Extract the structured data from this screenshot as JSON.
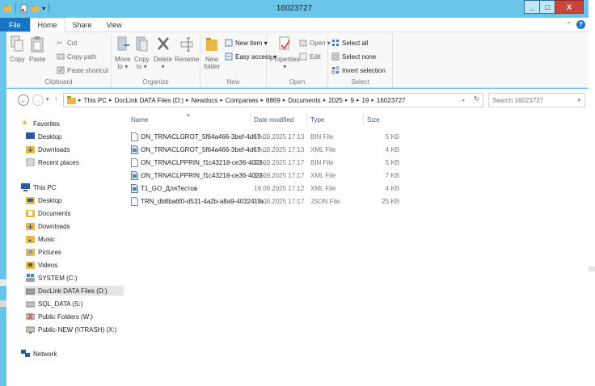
{
  "window": {
    "title": "16023727"
  },
  "caption_buttons": {
    "minimize": "_",
    "maximize": "□",
    "close": "X"
  },
  "ribbon_tabs": [
    {
      "label": "File"
    },
    {
      "label": "Home"
    },
    {
      "label": "Share"
    },
    {
      "label": "View"
    }
  ],
  "ribbon": {
    "clipboard": {
      "label": "Clipboard",
      "copy": "Copy",
      "paste": "Paste",
      "cut": "Cut",
      "copy_path": "Copy path",
      "paste_shortcut": "Paste shortcut"
    },
    "organize": {
      "label": "Organize",
      "move_to": "Move\nto ▾",
      "copy_to": "Copy\nto ▾",
      "delete": "Delete",
      "delete_arrow": "▾",
      "rename": "Rename"
    },
    "new": {
      "label": "New",
      "new_folder": "New\nfolder",
      "new_item": "New item ▾",
      "easy_access": "Easy access ▾"
    },
    "open": {
      "label": "Open",
      "properties": "Properties",
      "properties_arrow": "▾",
      "open": "Open ▾",
      "edit": "Edit"
    },
    "select": {
      "label": "Select",
      "select_all": "Select all",
      "select_none": "Select none",
      "invert_selection": "Invert selection"
    }
  },
  "addressbar": {
    "crumbs": [
      "This PC",
      "DocLink DATA Files (D:)",
      "Newdocs",
      "Companies",
      "8869",
      "Documents",
      "2025",
      "9",
      "19",
      "16023727"
    ],
    "search_placeholder": "Search 16023727"
  },
  "nav_pane": {
    "favorites": "Favorites",
    "favorites_items": [
      "Desktop",
      "Downloads",
      "Recent places"
    ],
    "this_pc": "This PC",
    "this_pc_items": [
      "Desktop",
      "Documents",
      "Downloads",
      "Music",
      "Pictures",
      "Videos",
      "SYSTEM (C:)",
      "DocLink DATA Files (D:)",
      "SQL_DATA (S:)",
      "Public Folders (W:)",
      "Public-NEW (\\\\TRASH) (X:)"
    ],
    "network": "Network"
  },
  "file_list": {
    "columns": {
      "name": "Name",
      "date": "Date modified",
      "type": "Type",
      "size": "Size"
    },
    "rows": [
      {
        "name": "ON_TRNACLGROT_5f64a466-3bef-4d67-...",
        "date": "19.09.2025 17:13",
        "type": "BIN File",
        "size": "5 KB",
        "icon": "bin-file"
      },
      {
        "name": "ON_TRNACLGROT_5f64a466-3bef-4d67-...",
        "date": "19.09.2025 17:13",
        "type": "XML File",
        "size": "4 KB",
        "icon": "xml-file"
      },
      {
        "name": "ON_TRNACLPPRIN_f1c43218-ce36-4023-...",
        "date": "19.09.2025 17:17",
        "type": "BIN File",
        "size": "5 KB",
        "icon": "bin-file"
      },
      {
        "name": "ON_TRNACLPPRIN_f1c43218-ce36-4023-...",
        "date": "19.09.2025 17:17",
        "type": "XML File",
        "size": "7 KB",
        "icon": "xml-file"
      },
      {
        "name": "T1_GO_ДляТестов",
        "date": "19.09.2025 17:12",
        "type": "XML File",
        "size": "4 KB",
        "icon": "xml-file"
      },
      {
        "name": "TRN_db8ba6f0-d531-4a2b-a8a9-403241fa...",
        "date": "19.09.2025 17:17",
        "type": "JSON File",
        "size": "25 KB",
        "icon": "json-file"
      }
    ]
  },
  "colors": {
    "titlebar": "#6ac5ea",
    "file_tab": "#1a74c6",
    "close_button": "#c7463d",
    "folder": "#e8b84a"
  }
}
